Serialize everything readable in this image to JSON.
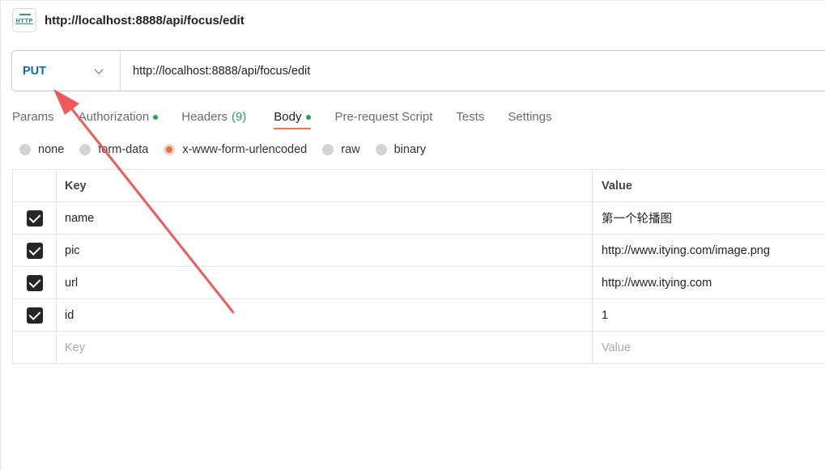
{
  "title_bar": {
    "icon_text": "HTTP",
    "title": "http://localhost:8888/api/focus/edit"
  },
  "url_bar": {
    "method": "PUT",
    "url": "http://localhost:8888/api/focus/edit"
  },
  "tabs": [
    {
      "label": "Params"
    },
    {
      "label": "Authorization",
      "indicator": "dot"
    },
    {
      "label": "Headers",
      "count": "(9)"
    },
    {
      "label": "Body",
      "indicator": "dot",
      "active": true
    },
    {
      "label": "Pre-request Script"
    },
    {
      "label": "Tests"
    },
    {
      "label": "Settings"
    }
  ],
  "body_types": [
    {
      "label": "none"
    },
    {
      "label": "form-data"
    },
    {
      "label": "x-www-form-urlencoded",
      "selected": true
    },
    {
      "label": "raw"
    },
    {
      "label": "binary"
    }
  ],
  "table": {
    "headers": {
      "key": "Key",
      "value": "Value"
    },
    "rows": [
      {
        "key": "name",
        "value": "第一个轮播图",
        "checked": true
      },
      {
        "key": "pic",
        "value": "http://www.itying.com/image.png",
        "checked": true
      },
      {
        "key": "url",
        "value": "http://www.itying.com",
        "checked": true
      },
      {
        "key": "id",
        "value": "1",
        "checked": true
      }
    ],
    "placeholder": {
      "key": "Key",
      "value": "Value"
    }
  },
  "colors": {
    "accent": "#ff6c37",
    "method": "#0d6bb5",
    "indicator": "#1ba84a",
    "annotation_arrow": "#f0585a"
  }
}
